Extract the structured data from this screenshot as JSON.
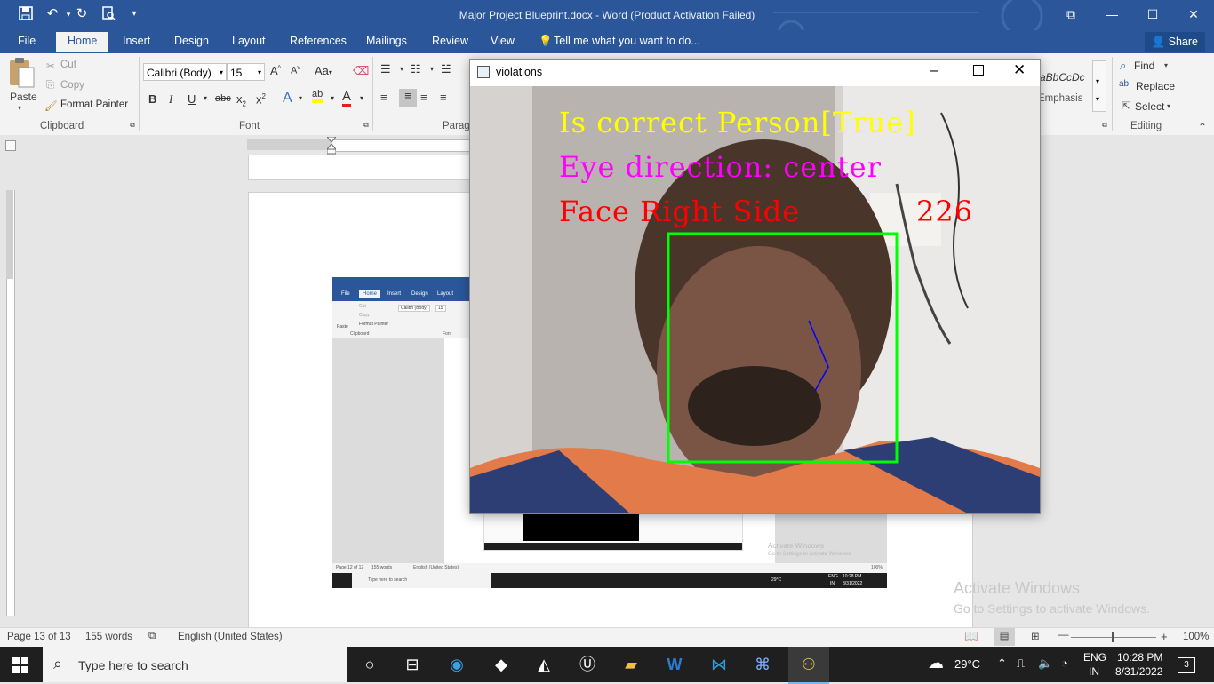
{
  "titlebar": {
    "document_title": "Major Project Blueprint.docx - Word (Product Activation Failed)",
    "restore_label": "⧉",
    "minimize_label": "—",
    "maximize_label": "☐",
    "close_label": "✕"
  },
  "tabs": [
    {
      "label": "File"
    },
    {
      "label": "Home"
    },
    {
      "label": "Insert"
    },
    {
      "label": "Design"
    },
    {
      "label": "Layout"
    },
    {
      "label": "References"
    },
    {
      "label": "Mailings"
    },
    {
      "label": "Review"
    },
    {
      "label": "View"
    }
  ],
  "tell_me": "Tell me what you want to do...",
  "share_label": "Share",
  "clipboard": {
    "paste": "Paste",
    "cut": "Cut",
    "copy": "Copy",
    "format_painter": "Format Painter",
    "group": "Clipboard"
  },
  "font": {
    "family": "Calibri (Body)",
    "size": "15",
    "group": "Font",
    "case_label": "Aa"
  },
  "paragraph_group": "Parag",
  "styles": {
    "preview": "aBbCcDc",
    "name": "Emphasis"
  },
  "editing": {
    "find": "Find",
    "replace": "Replace",
    "select": "Select",
    "group": "Editing"
  },
  "status": {
    "page": "Page 13 of 13",
    "words": "155 words",
    "language": "English (United States)",
    "zoom": "100%"
  },
  "watermark": {
    "title": "Activate Windows",
    "subtitle": "Go to Settings to activate Windows."
  },
  "taskbar": {
    "search_placeholder": "Type here to search",
    "weather": "29°C",
    "lang_top": "ENG",
    "lang_bottom": "IN",
    "time": "10:28 PM",
    "date": "8/31/2022",
    "notifications": "3"
  },
  "violations_window": {
    "title": "violations",
    "line1": "Is correct Person[True]",
    "line2": "Eye direction: center",
    "line3": "Face Right Side",
    "counter": "226",
    "colors": {
      "line1": "#ffff00",
      "line2": "#ff00ff",
      "line3": "#ff0000",
      "box": "#00ff00",
      "nose": "#0000ff"
    }
  },
  "thumbnail": {
    "tabs": [
      "File",
      "Home",
      "Insert",
      "Design",
      "Layout"
    ],
    "cut": "Cut",
    "copy": "Copy",
    "format_painter": "Format Painter",
    "paste": "Paste",
    "clipboard": "Clipboard",
    "font_family": "Calibri (Body)",
    "font_size": "15",
    "font": "Font",
    "status_page": "Page 12 of 12",
    "status_words": "155 words",
    "status_lang": "English (United States)",
    "zoom": "100%",
    "search": "Type here to search",
    "temp": "29°C",
    "lang": "ENG",
    "lang2": "IN",
    "time": "10:28 PM",
    "date": "8/31/2022",
    "wm_title": "Activate Windows",
    "wm_sub": "Go to Settings to activate Windows."
  }
}
